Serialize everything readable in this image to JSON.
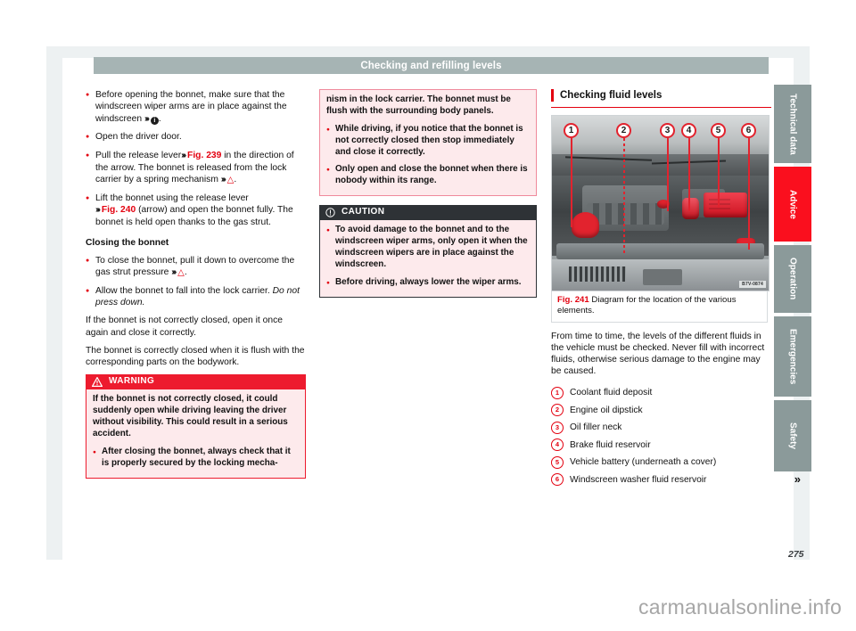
{
  "header": {
    "title": "Checking and refilling levels"
  },
  "page_number": "275",
  "watermark": "carmanualsonline.info",
  "column_left": {
    "bullets": [
      {
        "text_before": "Before opening the bonnet, make sure that the windscreen wiper arms are in place against the windscreen ",
        "ref": "",
        "text_after": " ."
      },
      {
        "text": "Open the driver door."
      }
    ],
    "b1_part1": "Before opening the bonnet, make sure that the windscreen wiper arms are in place against the windscreen",
    "b2": "Open the driver door.",
    "b3_part1": "Pull the release lever",
    "b3_fig": "Fig. 239",
    "b3_part2": "in the direction of the arrow. The bonnet is released from the lock carrier by a spring mechanism",
    "b4_part1": "Lift the bonnet using the release lever",
    "b4_fig": "Fig. 240",
    "b4_part2": "(arrow) and open the bonnet fully. The bonnet is held open thanks to the gas strut.",
    "subheading": "Closing the bonnet",
    "b5_part1": "To close the bonnet, pull it down to overcome the gas strut pressure",
    "b6_part1": "Allow the bonnet to fall into the lock carrier.",
    "b6_italic": "Do not press down.",
    "p1": "If the bonnet is not correctly closed, open it once again and close it correctly.",
    "p2": "The bonnet is correctly closed when it is flush with the corresponding parts on the bodywork.",
    "warning": {
      "label": "WARNING",
      "icon": "warning-triangle-icon",
      "paragraph": "If the bonnet is not correctly closed, it could suddenly open while driving leaving the driver without visibility. This could result in a serious accident.",
      "bullet": "After closing the bonnet, always check that it is properly secured by the locking mecha-"
    }
  },
  "column_middle": {
    "warning_cont": {
      "paragraph": "nism in the lock carrier. The bonnet must be flush with the surrounding body panels.",
      "bullets": [
        "While driving, if you notice that the bonnet is not correctly closed then stop immediately and close it correctly.",
        "Only open and close the bonnet when there is nobody within its range."
      ]
    },
    "caution": {
      "label": "CAUTION",
      "icon": "caution-circle-icon",
      "bullets": [
        "To avoid damage to the bonnet and to the windscreen wiper arms, only open it when the windscreen wipers are in place against the windscreen.",
        "Before driving, always lower the wiper arms."
      ]
    }
  },
  "column_right": {
    "section_title": "Checking fluid levels",
    "figure": {
      "number": "Fig. 241",
      "caption": "Diagram for the location of the various elements.",
      "image_code": "B7V-0874",
      "callouts": [
        "1",
        "2",
        "3",
        "4",
        "5",
        "6"
      ]
    },
    "intro": "From time to time, the levels of the different fluids in the vehicle must be checked. Never fill with incorrect fluids, otherwise serious damage to the engine may be caused.",
    "legend": [
      {
        "num": "1",
        "label": "Coolant fluid deposit"
      },
      {
        "num": "2",
        "label": "Engine oil dipstick"
      },
      {
        "num": "3",
        "label": "Oil filler neck"
      },
      {
        "num": "4",
        "label": "Brake fluid reservoir"
      },
      {
        "num": "5",
        "label": "Vehicle battery (underneath a cover)"
      },
      {
        "num": "6",
        "label": "Windscreen washer fluid reservoir"
      }
    ],
    "continue_arrow": "»"
  },
  "side_tabs": [
    {
      "label": "Technical data",
      "active": false
    },
    {
      "label": "Advice",
      "active": true
    },
    {
      "label": "Operation",
      "active": false
    },
    {
      "label": "Emergencies",
      "active": false
    },
    {
      "label": "Safety",
      "active": false
    }
  ],
  "colors": {
    "accent_red": "#e3000f",
    "warning_red": "#ed1b2e",
    "caution_dark": "#2e3236",
    "tab_gray": "#8b9a9a",
    "tab_active": "#fa0f1e",
    "header_bar": "#a6b4b4",
    "page_bg": "#edf1f2"
  }
}
